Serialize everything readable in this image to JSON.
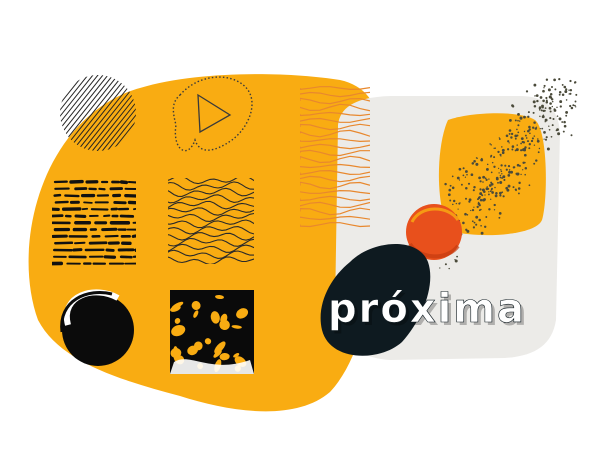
{
  "brand": {
    "name": "próxima"
  },
  "colors": {
    "orange": "#F9AC12",
    "dark": "#0E1A20",
    "red_orange": "#E8501C",
    "panel": "#ECEBE8",
    "line_orange": "#E8882E",
    "dots": "#4A4A3A"
  },
  "icons": [
    "diagonal-lines-icon",
    "play-icon",
    "wavy-lines-icon",
    "dashes-pattern-icon",
    "maze-pattern-icon",
    "circle-brush-icon",
    "cell-pattern-icon",
    "stipple-icon"
  ]
}
